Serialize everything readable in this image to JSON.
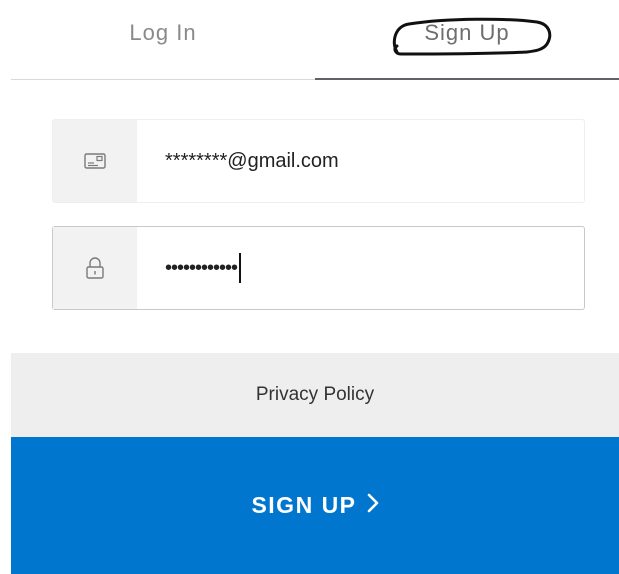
{
  "tabs": {
    "login_label": "Log In",
    "signup_label": "Sign Up",
    "active": "signup"
  },
  "form": {
    "email": {
      "icon": "email-card-icon",
      "value": "********@gmail.com"
    },
    "password": {
      "icon": "lock-icon",
      "value": "••••••••••••"
    }
  },
  "privacy": {
    "label": "Privacy Policy"
  },
  "submit": {
    "label": "SIGN UP",
    "icon": "chevron-right-icon"
  },
  "colors": {
    "primary": "#0176cf",
    "tab_text": "#8a8a8a",
    "privacy_bg": "#eeeeee"
  }
}
